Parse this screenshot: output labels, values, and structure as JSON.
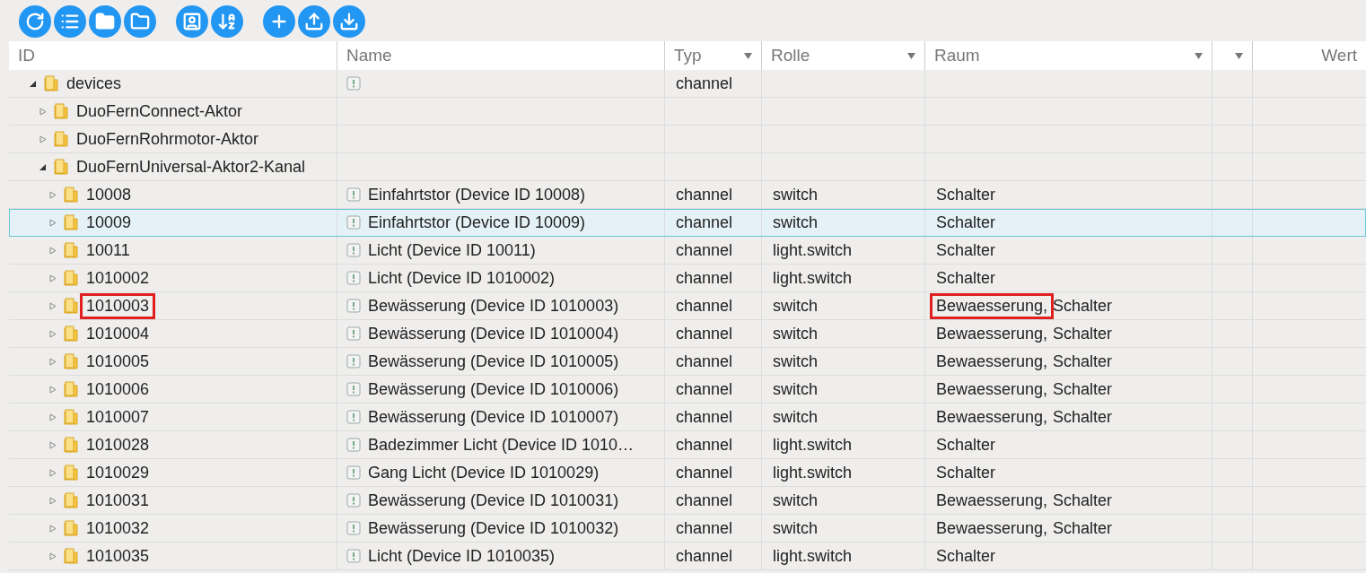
{
  "toolbar": [
    [
      {
        "kind": "refresh"
      },
      {
        "kind": "list"
      },
      {
        "kind": "folder"
      },
      {
        "kind": "folder-outline"
      }
    ],
    [
      {
        "kind": "role"
      },
      {
        "kind": "sort"
      }
    ],
    [
      {
        "kind": "add"
      },
      {
        "kind": "upload"
      },
      {
        "kind": "download"
      }
    ]
  ],
  "columns": [
    {
      "label": "ID",
      "filter": false
    },
    {
      "label": "Name",
      "filter": false
    },
    {
      "label": "Typ",
      "filter": true
    },
    {
      "label": "Rolle",
      "filter": true
    },
    {
      "label": "Raum",
      "filter": true
    },
    {
      "filter": true
    },
    {
      "label": "Wert",
      "filter": false
    }
  ],
  "tree": [
    {
      "id": "devices",
      "expanded": true,
      "state_icon": true,
      "typ": "channel",
      "selected": false,
      "children": [
        {
          "id": "DuoFernConnect-Aktor",
          "expanded": false,
          "selected": false
        },
        {
          "id": "DuoFernRohrmotor-Aktor",
          "expanded": false,
          "selected": false
        },
        {
          "id": "DuoFernUniversal-Aktor2-Kanal",
          "expanded": true,
          "selected": false,
          "children": [
            {
              "id": "10008",
              "expanded": false,
              "state_icon": true,
              "name": "Einfahrtstor (Device ID 10008)",
              "typ": "channel",
              "rolle": "switch",
              "rooms": [
                "Schalter"
              ],
              "selected": false
            },
            {
              "id": "10009",
              "expanded": false,
              "state_icon": true,
              "name": "Einfahrtstor (Device ID 10009)",
              "typ": "channel",
              "rolle": "switch",
              "rooms": [
                "Schalter"
              ],
              "selected": true
            },
            {
              "id": "10011",
              "expanded": false,
              "state_icon": true,
              "name": "Licht (Device ID 10011)",
              "typ": "channel",
              "rolle": "light.switch",
              "rooms": [
                "Schalter"
              ],
              "selected": false
            },
            {
              "id": "1010002",
              "expanded": false,
              "state_icon": true,
              "name": "Licht (Device ID 1010002)",
              "typ": "channel",
              "rolle": "light.switch",
              "rooms": [
                "Schalter"
              ],
              "selected": false
            },
            {
              "id": "1010003",
              "expanded": false,
              "state_icon": true,
              "name": "Bewässerung (Device ID 1010003)",
              "typ": "channel",
              "rolle": "switch",
              "rooms": [
                "Bewaesserung,",
                "Schalter"
              ],
              "selected": false,
              "annotated": true
            },
            {
              "id": "1010004",
              "expanded": false,
              "state_icon": true,
              "name": "Bewässerung (Device ID 1010004)",
              "typ": "channel",
              "rolle": "switch",
              "rooms": [
                "Bewaesserung,",
                "Schalter"
              ],
              "selected": false
            },
            {
              "id": "1010005",
              "expanded": false,
              "state_icon": true,
              "name": "Bewässerung (Device ID 1010005)",
              "typ": "channel",
              "rolle": "switch",
              "rooms": [
                "Bewaesserung,",
                "Schalter"
              ],
              "selected": false
            },
            {
              "id": "1010006",
              "expanded": false,
              "state_icon": true,
              "name": "Bewässerung (Device ID 1010006)",
              "typ": "channel",
              "rolle": "switch",
              "rooms": [
                "Bewaesserung,",
                "Schalter"
              ],
              "selected": false
            },
            {
              "id": "1010007",
              "expanded": false,
              "state_icon": true,
              "name": "Bewässerung (Device ID 1010007)",
              "typ": "channel",
              "rolle": "switch",
              "rooms": [
                "Bewaesserung,",
                "Schalter"
              ],
              "selected": false
            },
            {
              "id": "1010028",
              "expanded": false,
              "state_icon": true,
              "name": "Badezimmer Licht (Device ID 1010…",
              "typ": "channel",
              "rolle": "light.switch",
              "rooms": [
                "Schalter"
              ],
              "selected": false
            },
            {
              "id": "1010029",
              "expanded": false,
              "state_icon": true,
              "name": "Gang Licht (Device ID 1010029)",
              "typ": "channel",
              "rolle": "light.switch",
              "rooms": [
                "Schalter"
              ],
              "selected": false
            },
            {
              "id": "1010031",
              "expanded": false,
              "state_icon": true,
              "name": "Bewässerung (Device ID 1010031)",
              "typ": "channel",
              "rolle": "switch",
              "rooms": [
                "Bewaesserung,",
                "Schalter"
              ],
              "selected": false
            },
            {
              "id": "1010032",
              "expanded": false,
              "state_icon": true,
              "name": "Bewässerung (Device ID 1010032)",
              "typ": "channel",
              "rolle": "switch",
              "rooms": [
                "Bewaesserung,",
                "Schalter"
              ],
              "selected": false
            },
            {
              "id": "1010035",
              "expanded": false,
              "state_icon": true,
              "name": "Licht (Device ID 1010035)",
              "typ": "channel",
              "rolle": "light.switch",
              "rooms": [
                "Schalter"
              ],
              "selected": false
            }
          ]
        }
      ]
    }
  ]
}
